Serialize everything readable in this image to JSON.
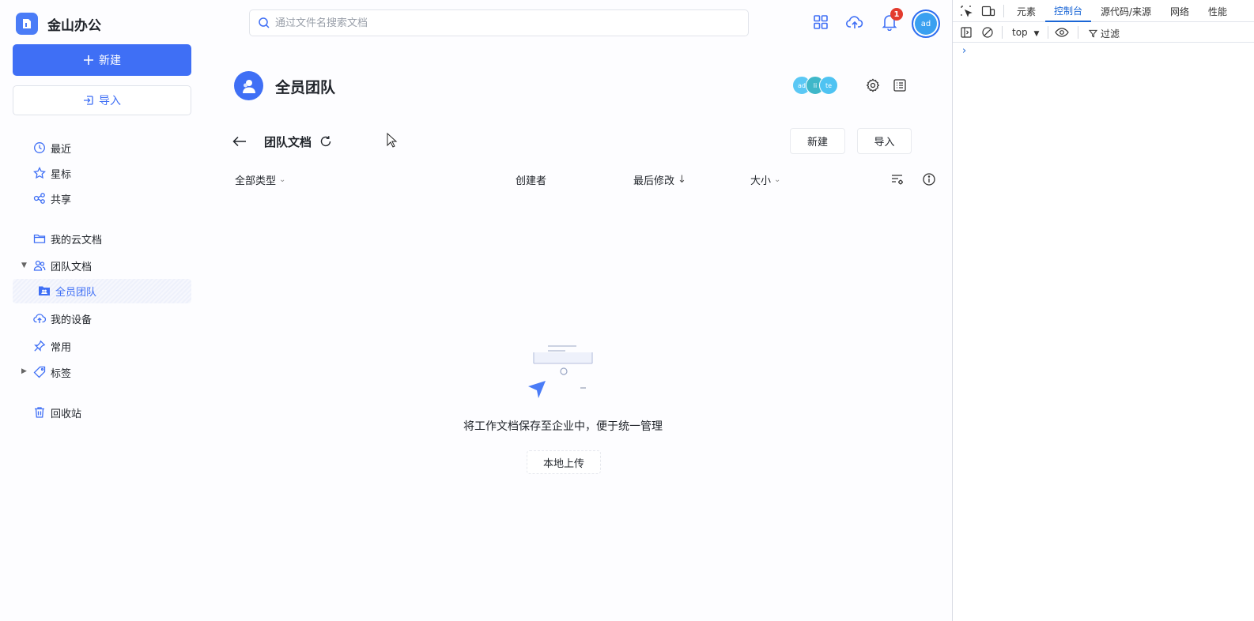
{
  "sidebar": {
    "brand": "金山办公",
    "new_button": "新建",
    "import_button": "导入",
    "items": [
      {
        "label": "最近"
      },
      {
        "label": "星标"
      },
      {
        "label": "共享"
      },
      {
        "label": "我的云文档"
      },
      {
        "label": "团队文档"
      },
      {
        "label": "全员团队"
      },
      {
        "label": "我的设备"
      },
      {
        "label": "常用"
      },
      {
        "label": "标签"
      },
      {
        "label": "回收站"
      }
    ]
  },
  "topbar": {
    "search_placeholder": "通过文件名搜索文档",
    "notification_count": "1",
    "avatar": "ad"
  },
  "main": {
    "team_title": "全员团队",
    "members": [
      "ad",
      "li",
      "te"
    ],
    "folder_title": "团队文档",
    "new_button": "新建",
    "import_button": "导入",
    "columns": {
      "type": "全部类型",
      "creator": "创建者",
      "modified": "最后修改",
      "modified_arrow": "↓",
      "size": "大小"
    },
    "empty_message": "将工作文档保存至企业中，便于统一管理",
    "upload_button": "本地上传"
  },
  "devtools": {
    "tabs": [
      "元素",
      "控制台",
      "源代码/来源",
      "网络",
      "性能"
    ],
    "active_tab": "控制台",
    "context": "top",
    "filter": "过滤",
    "prompt": "›"
  },
  "colors": {
    "accent": "#3f6ff5",
    "badge": "#e33b2e",
    "devtools_accent": "#1a66d6"
  }
}
